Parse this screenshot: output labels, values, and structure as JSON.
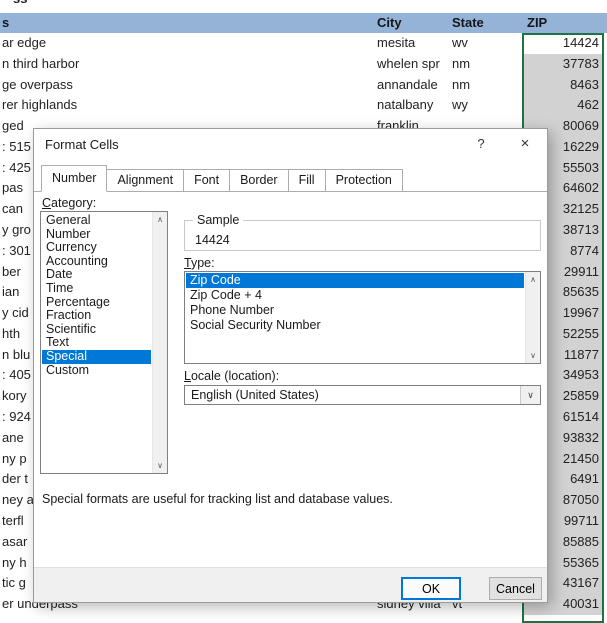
{
  "sheet": {
    "clipped_top_fragment": "ss",
    "header": {
      "address_partial": "s",
      "city": "City",
      "state": "State",
      "zip": "ZIP"
    },
    "rows": [
      {
        "address": "ar edge",
        "city": "mesita",
        "state": "wv",
        "zip": "14424"
      },
      {
        "address": "n third harbor",
        "city": "whelen spr",
        "state": "nm",
        "zip": "37783"
      },
      {
        "address": "ge overpass",
        "city": "annandale",
        "state": "nm",
        "zip": "8463"
      },
      {
        "address": "rer highlands",
        "city": "natalbany",
        "state": "wy",
        "zip": "462"
      },
      {
        "address": "ged",
        "city": "franklin",
        "state": "",
        "zip": "80069"
      },
      {
        "address": ": 515",
        "city": "",
        "state": "",
        "zip": "16229"
      },
      {
        "address": ": 425",
        "city": "",
        "state": "",
        "zip": "55503"
      },
      {
        "address": "pas",
        "city": "",
        "state": "",
        "zip": "64602"
      },
      {
        "address": "can",
        "city": "",
        "state": "",
        "zip": "32125"
      },
      {
        "address": "y gro",
        "city": "",
        "state": "",
        "zip": "38713"
      },
      {
        "address": ": 301",
        "city": "",
        "state": "",
        "zip": "8774"
      },
      {
        "address": "ber",
        "city": "",
        "state": "",
        "zip": "29911"
      },
      {
        "address": "ian",
        "city": "",
        "state": "",
        "zip": "85635"
      },
      {
        "address": "y cid",
        "city": "",
        "state": "",
        "zip": "19967"
      },
      {
        "address": "hth",
        "city": "",
        "state": "",
        "zip": "52255"
      },
      {
        "address": "n blu",
        "city": "",
        "state": "",
        "zip": "11877"
      },
      {
        "address": ": 405",
        "city": "",
        "state": "",
        "zip": "34953"
      },
      {
        "address": "kory",
        "city": "",
        "state": "",
        "zip": "25859"
      },
      {
        "address": ": 924",
        "city": "",
        "state": "",
        "zip": "61514"
      },
      {
        "address": "ane",
        "city": "",
        "state": "",
        "zip": "93832"
      },
      {
        "address": "ny p",
        "city": "",
        "state": "",
        "zip": "21450"
      },
      {
        "address": "der t",
        "city": "",
        "state": "",
        "zip": "6491"
      },
      {
        "address": "ney a",
        "city": "",
        "state": "",
        "zip": "87050"
      },
      {
        "address": "terfl",
        "city": "",
        "state": "",
        "zip": "99711"
      },
      {
        "address": "asar",
        "city": "",
        "state": "",
        "zip": "85885"
      },
      {
        "address": "ny h",
        "city": "",
        "state": "",
        "zip": "55365"
      },
      {
        "address": "tic g",
        "city": "",
        "state": "",
        "zip": "43167"
      },
      {
        "address": "er underpass",
        "city": "sidney villa",
        "state": "vt",
        "zip": "40031"
      }
    ]
  },
  "dialog": {
    "title": "Format Cells",
    "tabs": [
      "Number",
      "Alignment",
      "Font",
      "Border",
      "Fill",
      "Protection"
    ],
    "active_tab_index": 0,
    "category": {
      "label": "Category:",
      "items": [
        "General",
        "Number",
        "Currency",
        "Accounting",
        "Date",
        "Time",
        "Percentage",
        "Fraction",
        "Scientific",
        "Text",
        "Special",
        "Custom"
      ],
      "selected_index": 10
    },
    "sample": {
      "label": "Sample",
      "value": "14424"
    },
    "type": {
      "label": "Type:",
      "items": [
        "Zip Code",
        "Zip Code + 4",
        "Phone Number",
        "Social Security Number"
      ],
      "selected_index": 0
    },
    "locale": {
      "label": "Locale (location):",
      "value": "English (United States)"
    },
    "description": "Special formats are useful for tracking list and database values.",
    "buttons": {
      "ok": "OK",
      "cancel": "Cancel"
    }
  },
  "icons": {
    "help": "?",
    "close": "×",
    "scroll_up": "∧",
    "scroll_down": "∨",
    "dropdown": "∨"
  },
  "colors": {
    "header_blue": "#95B3D7",
    "selection_gray": "#D2D2D2",
    "range_border_green": "#1F7244",
    "highlight_blue": "#0078D7"
  }
}
